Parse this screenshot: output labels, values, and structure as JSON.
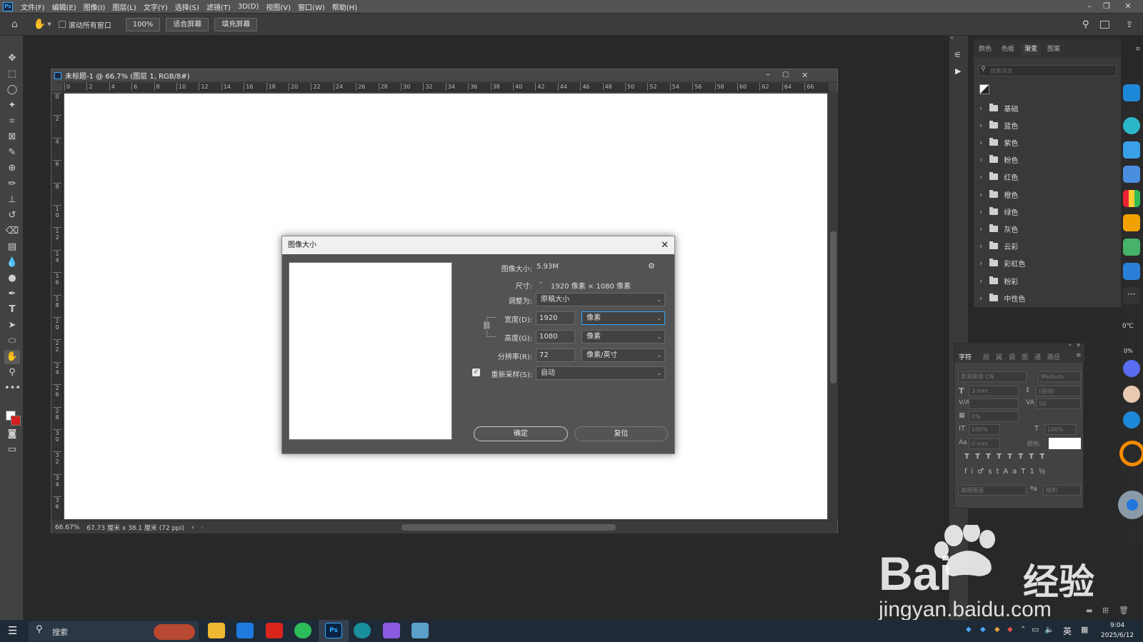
{
  "menubar": {
    "items": [
      "文件(F)",
      "编辑(E)",
      "图像(I)",
      "图层(L)",
      "文字(Y)",
      "选择(S)",
      "滤镜(T)",
      "3D(D)",
      "视图(V)",
      "窗口(W)",
      "帮助(H)"
    ],
    "ps_icon": "Ps"
  },
  "options": {
    "scroll_all": "滚动所有窗口",
    "zoom": "100%",
    "fit": "适合屏幕",
    "fill": "填充屏幕"
  },
  "document": {
    "title": "未标题-1 @ 66.7% (图层 1, RGB/8#)",
    "ruler_h": [
      "0",
      "2",
      "4",
      "6",
      "8",
      "10",
      "12",
      "14",
      "16",
      "18",
      "20",
      "22",
      "24",
      "26",
      "28",
      "30",
      "32",
      "34",
      "36",
      "38",
      "40",
      "42",
      "44",
      "46",
      "48",
      "50",
      "52",
      "54",
      "56",
      "58",
      "60",
      "62",
      "64",
      "66"
    ],
    "ruler_v": [
      "0",
      "2",
      "4",
      "6",
      "8",
      "1\n0",
      "1\n2",
      "1\n4",
      "1\n6",
      "1\n8",
      "2\n0",
      "2\n2",
      "2\n4",
      "2\n6",
      "2\n8",
      "3\n0",
      "3\n2",
      "3\n4",
      "3\n6"
    ],
    "status_zoom": "66.67%",
    "status_info": "67.73 厘米 x 38.1 厘米 (72 ppi)"
  },
  "dialog": {
    "title": "图像大小",
    "image_size_label": "图像大小:",
    "image_size_value": "5.93M",
    "dimensions_label": "尺寸:",
    "dimensions_value": "1920 像素  ×  1080 像素",
    "fit_label": "调整为:",
    "fit_value": "原稿大小",
    "width_label": "宽度(D):",
    "width_value": "1920",
    "width_unit": "像素",
    "height_label": "高度(G):",
    "height_value": "1080",
    "height_unit": "像素",
    "res_label": "分辨率(R):",
    "res_value": "72",
    "res_unit": "像素/英寸",
    "resample_label": "重新采样(S):",
    "resample_value": "自动",
    "ok": "确定",
    "reset": "复位"
  },
  "right_panel": {
    "tabs": [
      "颜色",
      "色板",
      "渐变",
      "图案"
    ],
    "active_tab": "渐变",
    "search_placeholder": "搜索渐变",
    "groups": [
      "基础",
      "蓝色",
      "紫色",
      "粉色",
      "红色",
      "橙色",
      "绿色",
      "灰色",
      "云彩",
      "彩虹色",
      "粉彩",
      "中性色"
    ]
  },
  "char_panel": {
    "tabs": [
      "字符",
      "段",
      "属",
      "调",
      "图",
      "通",
      "路径"
    ],
    "font": "思源黑体 CN",
    "weight": "Medium",
    "size": "3 mm",
    "leading": "(自动)",
    "tracking": "50",
    "scale": "0%",
    "vscale": "100%",
    "hscale": "100%",
    "baseline": "0 mm",
    "color_label": "颜色:",
    "lang": "美国英语",
    "aa": "锐利"
  },
  "taskbar": {
    "search": "搜索",
    "time": "9:04",
    "date": "2025/6/12",
    "ime": "英"
  },
  "watermark": {
    "brand": "Bai",
    "brand2": "经验",
    "url": "jingyan.baidu.com"
  },
  "colors": {
    "accent": "#31a8ff",
    "foreground_swatch": "#ffffff",
    "background_swatch": "#d42020"
  }
}
